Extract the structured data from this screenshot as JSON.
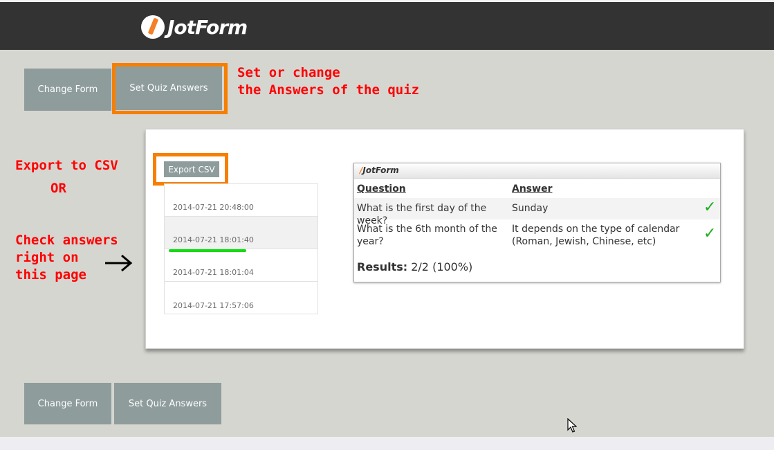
{
  "header": {
    "brand": "JotForm"
  },
  "toolbar_top": {
    "change_form": "Change Form",
    "set_quiz_answers": "Set Quiz Answers"
  },
  "toolbar_bottom": {
    "change_form": "Change Form",
    "set_quiz_answers": "Set Quiz Answers"
  },
  "annotations": {
    "set_answers": "Set or change\nthe Answers of the quiz",
    "export": "Export to CSV",
    "or": "OR",
    "check": "Check answers\nright on\nthis page"
  },
  "panel": {
    "export_label": "Export CSV",
    "submissions": [
      {
        "date": "2014-07-21 20:48:00",
        "selected": false
      },
      {
        "date": "2014-07-21 18:01:40",
        "selected": true
      },
      {
        "date": "2014-07-21 18:01:04",
        "selected": false
      },
      {
        "date": "2014-07-21 17:57:06",
        "selected": false
      }
    ]
  },
  "result_card": {
    "brand": "JotForm",
    "headers": {
      "question": "Question",
      "answer": "Answer"
    },
    "rows": [
      {
        "question": "What is the first day of the week?",
        "answer": "Sunday",
        "correct": true
      },
      {
        "question": "What is the 6th month of the year?",
        "answer": "It depends on the type of calendar (Roman, Jewish, Chinese, etc)",
        "correct": true
      }
    ],
    "results_label": "Results:",
    "results_value": "2/2 (100%)"
  },
  "colors": {
    "highlight_orange": "#f77f00",
    "annotation_red": "#ff0000",
    "underline_green": "#11dd11",
    "button_gray": "#8e9c9c",
    "header_dark": "#333333"
  },
  "icons": {
    "check": "checkmark-icon",
    "arrow": "arrow-right-icon",
    "cursor": "mouse-cursor-icon"
  }
}
